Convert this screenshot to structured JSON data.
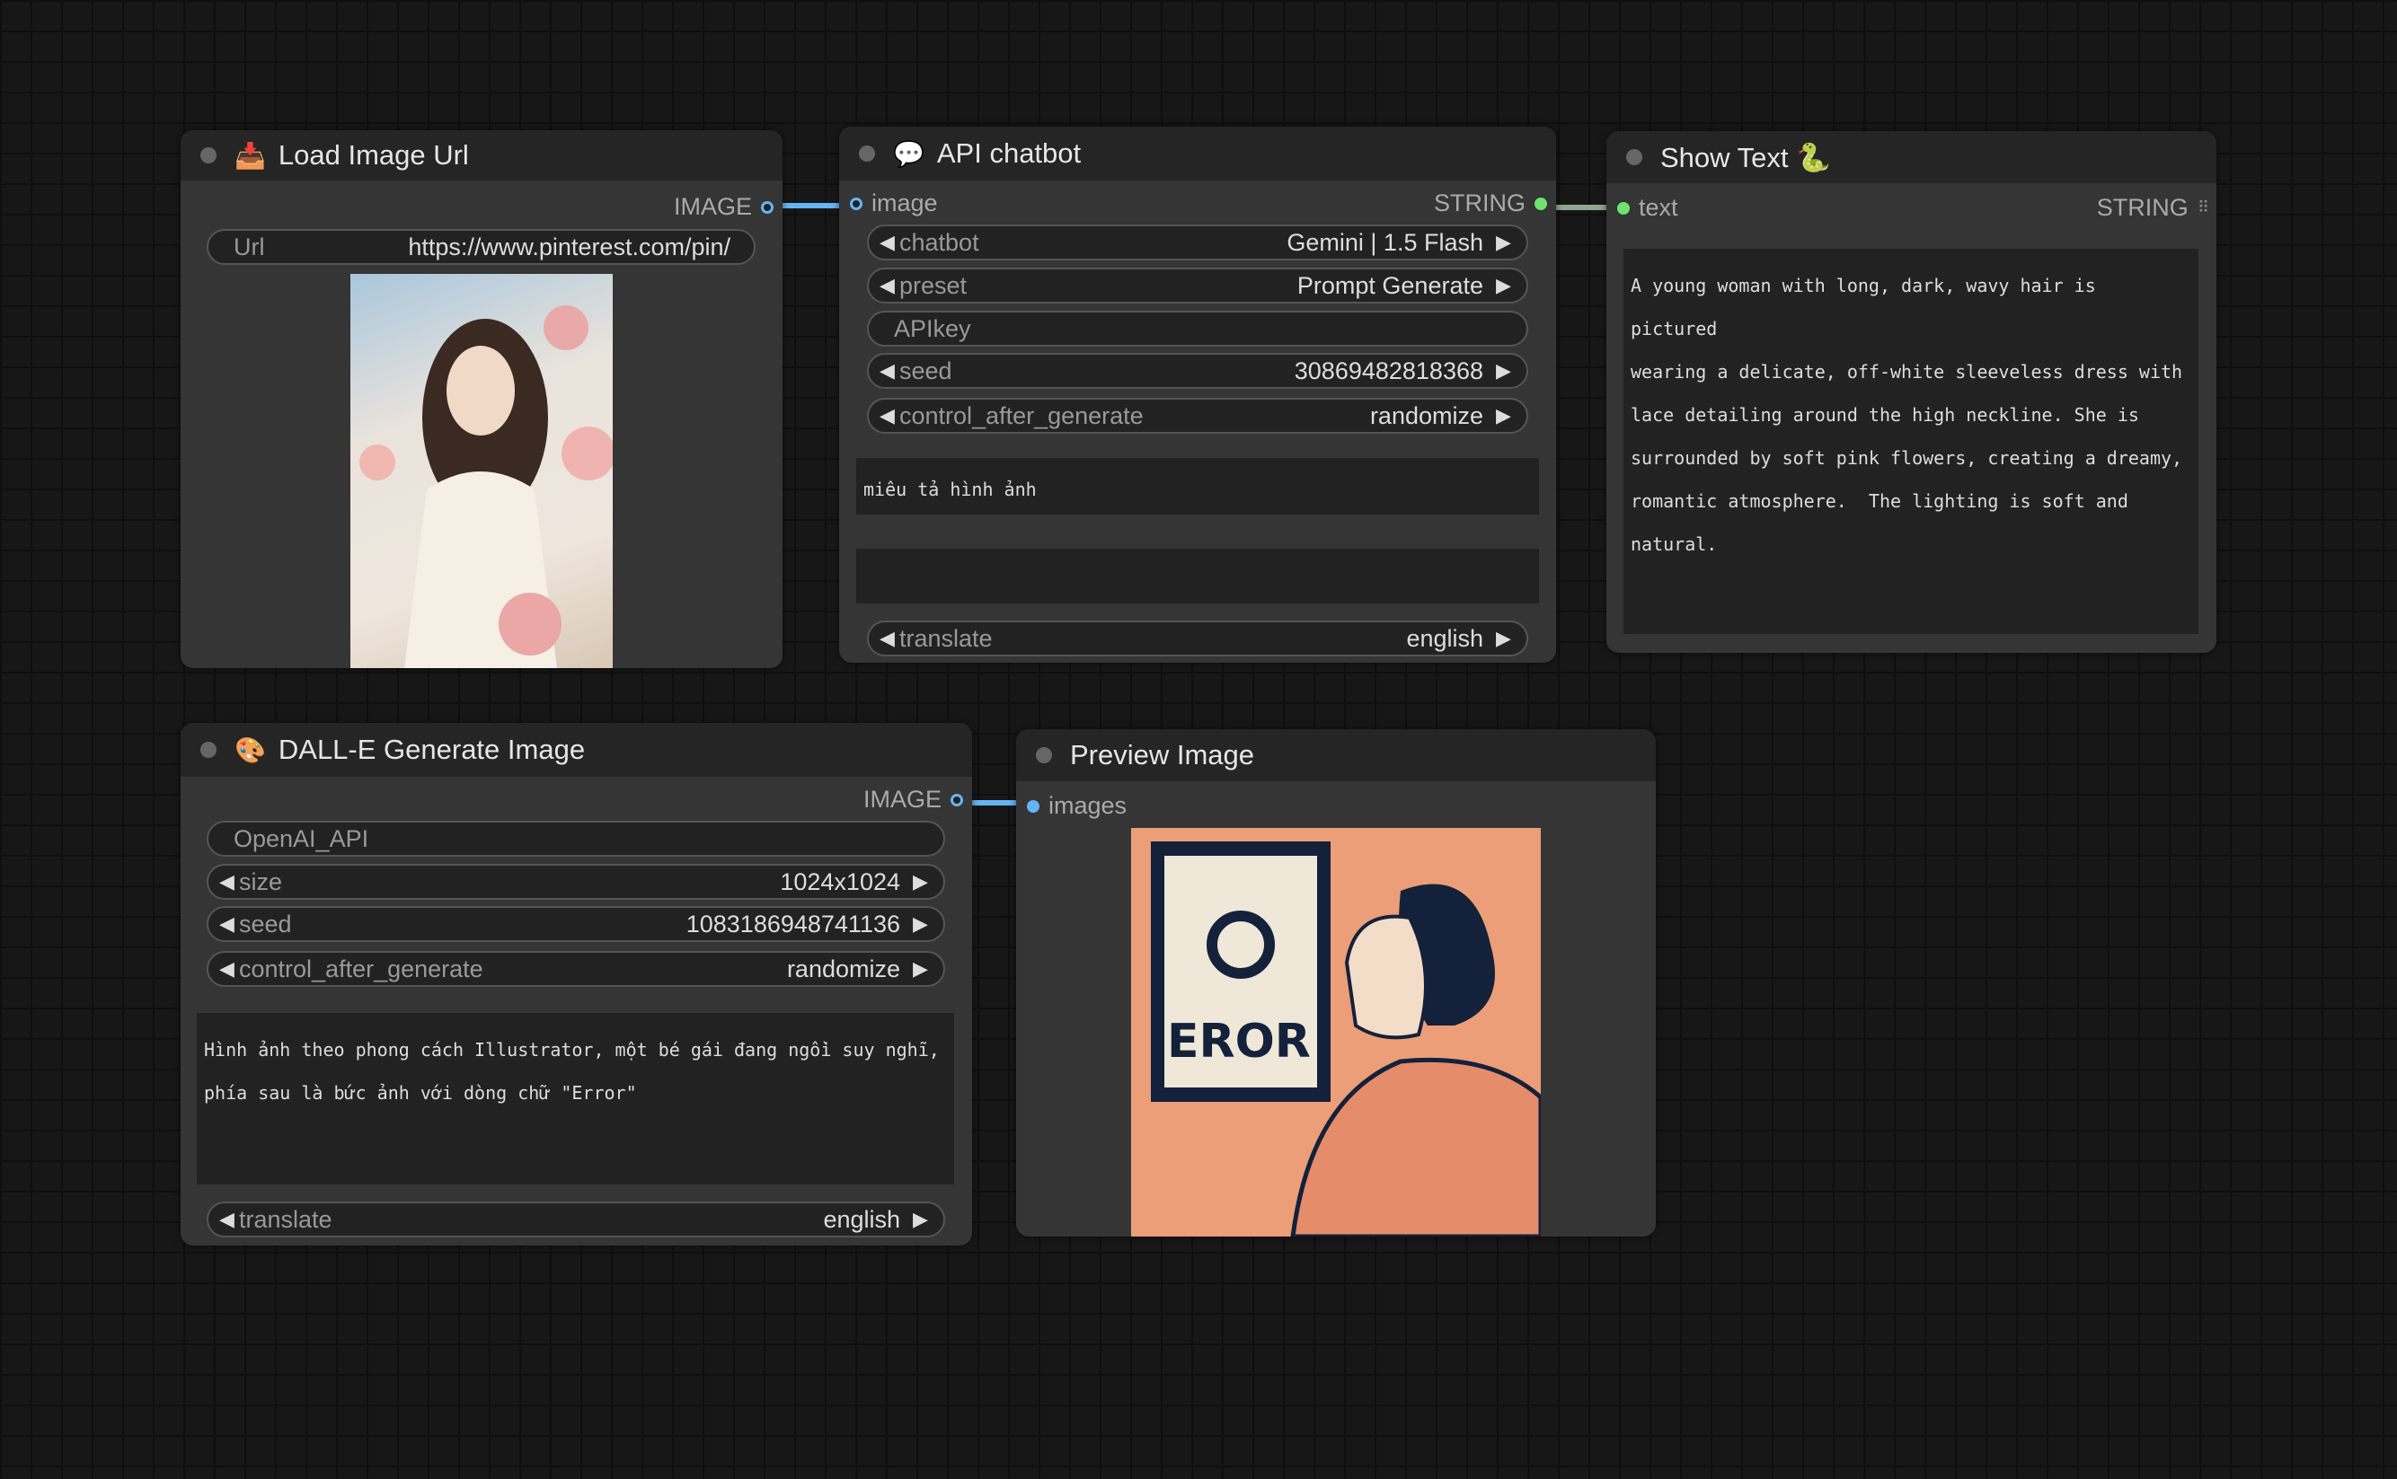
{
  "colors": {
    "image_link": "#64b5f6",
    "string_link": "#7fb87f",
    "string_slot": "#6fe26f"
  },
  "load_image": {
    "title": "Load Image Url",
    "icon": "inbox-tray-icon",
    "output": "IMAGE",
    "url_label": "Url",
    "url_value": "https://www.pinterest.com/pin/"
  },
  "chatbot": {
    "title": "API chatbot",
    "icon": "speech-bubble-icon",
    "input": "image",
    "output": "STRING",
    "widgets": [
      {
        "label": "chatbot",
        "value": "Gemini | 1.5 Flash"
      },
      {
        "label": "preset",
        "value": "Prompt Generate"
      },
      {
        "label": "APIkey",
        "value": ""
      },
      {
        "label": "seed",
        "value": "30869482818368"
      },
      {
        "label": "control_after_generate",
        "value": "randomize"
      }
    ],
    "prompt": "miêu tả hình ảnh",
    "prompt2": "",
    "translate": {
      "label": "translate",
      "value": "english"
    }
  },
  "show_text": {
    "title": "Show Text 🐍",
    "input": "text",
    "output": "STRING",
    "text": "A young woman with long, dark, wavy hair is pictured\nwearing a delicate, off-white sleeveless dress with\nlace detailing around the high neckline. She is\nsurrounded by soft pink flowers, creating a dreamy,\nromantic atmosphere.  The lighting is soft and\nnatural."
  },
  "dalle": {
    "title": "DALL-E Generate Image",
    "icon": "palette-icon",
    "output": "IMAGE",
    "api_label": "OpenAI_API",
    "widgets": [
      {
        "label": "size",
        "value": "1024x1024"
      },
      {
        "label": "seed",
        "value": "1083186948741136"
      },
      {
        "label": "control_after_generate",
        "value": "randomize"
      }
    ],
    "prompt": "Hình ảnh theo phong cách Illustrator, một bé gái đang ngồi suy nghĩ,\nphía sau là bức ảnh với dòng chữ \"Error\"",
    "translate": {
      "label": "translate",
      "value": "english"
    }
  },
  "preview": {
    "title": "Preview Image",
    "input": "images",
    "image_text": "EROR"
  }
}
